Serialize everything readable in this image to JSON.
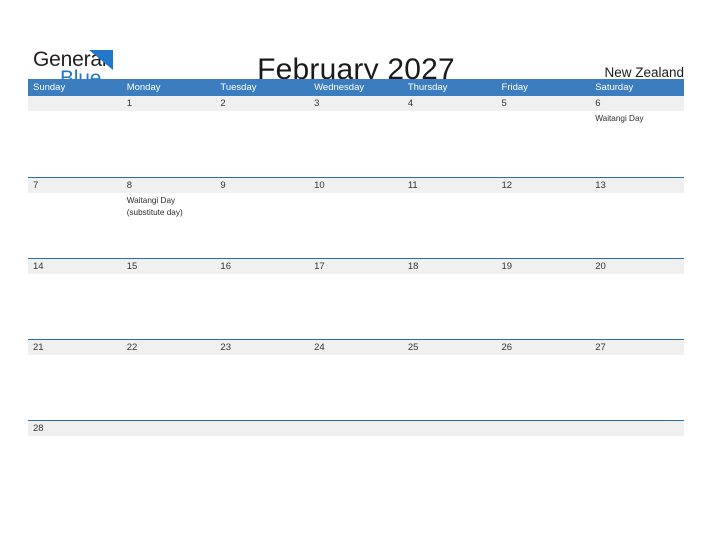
{
  "brand": {
    "line1": "General",
    "line2": "Blue",
    "triangle_color": "#2277c8"
  },
  "header": {
    "title": "February 2027",
    "country": "New Zealand"
  },
  "colors": {
    "header_blue": "#3b7dbf",
    "separator_blue": "#2e6da4",
    "date_band_gray": "#f0f0f0",
    "brand_blue": "#2277c8",
    "text": "#222222"
  },
  "calendar": {
    "day_headers": [
      "Sunday",
      "Monday",
      "Tuesday",
      "Wednesday",
      "Thursday",
      "Friday",
      "Saturday"
    ],
    "weeks": [
      [
        {
          "date": ""
        },
        {
          "date": "1"
        },
        {
          "date": "2"
        },
        {
          "date": "3"
        },
        {
          "date": "4"
        },
        {
          "date": "5"
        },
        {
          "date": "6",
          "events": [
            "Waitangi Day"
          ]
        }
      ],
      [
        {
          "date": "7"
        },
        {
          "date": "8",
          "events": [
            "Waitangi Day",
            "(substitute day)"
          ]
        },
        {
          "date": "9"
        },
        {
          "date": "10"
        },
        {
          "date": "11"
        },
        {
          "date": "12"
        },
        {
          "date": "13"
        }
      ],
      [
        {
          "date": "14"
        },
        {
          "date": "15"
        },
        {
          "date": "16"
        },
        {
          "date": "17"
        },
        {
          "date": "18"
        },
        {
          "date": "19"
        },
        {
          "date": "20"
        }
      ],
      [
        {
          "date": "21"
        },
        {
          "date": "22"
        },
        {
          "date": "23"
        },
        {
          "date": "24"
        },
        {
          "date": "25"
        },
        {
          "date": "26"
        },
        {
          "date": "27"
        }
      ],
      [
        {
          "date": "28"
        },
        {
          "date": ""
        },
        {
          "date": ""
        },
        {
          "date": ""
        },
        {
          "date": ""
        },
        {
          "date": ""
        },
        {
          "date": ""
        }
      ]
    ]
  }
}
